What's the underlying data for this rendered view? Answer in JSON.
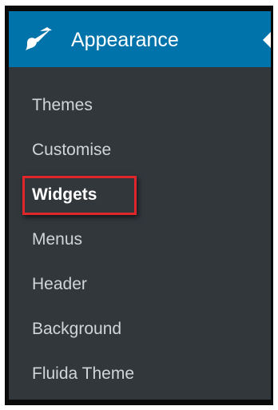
{
  "menu": {
    "section_title": "Appearance",
    "section_icon": "paintbrush-icon",
    "items": [
      {
        "label": "Themes",
        "current": false
      },
      {
        "label": "Customise",
        "current": false
      },
      {
        "label": "Widgets",
        "current": true
      },
      {
        "label": "Menus",
        "current": false
      },
      {
        "label": "Header",
        "current": false
      },
      {
        "label": "Background",
        "current": false
      },
      {
        "label": "Fluida Theme",
        "current": false
      }
    ]
  },
  "colors": {
    "header_bg": "#0073aa",
    "menu_bg": "#32373c",
    "highlight_border": "#e0262a"
  }
}
